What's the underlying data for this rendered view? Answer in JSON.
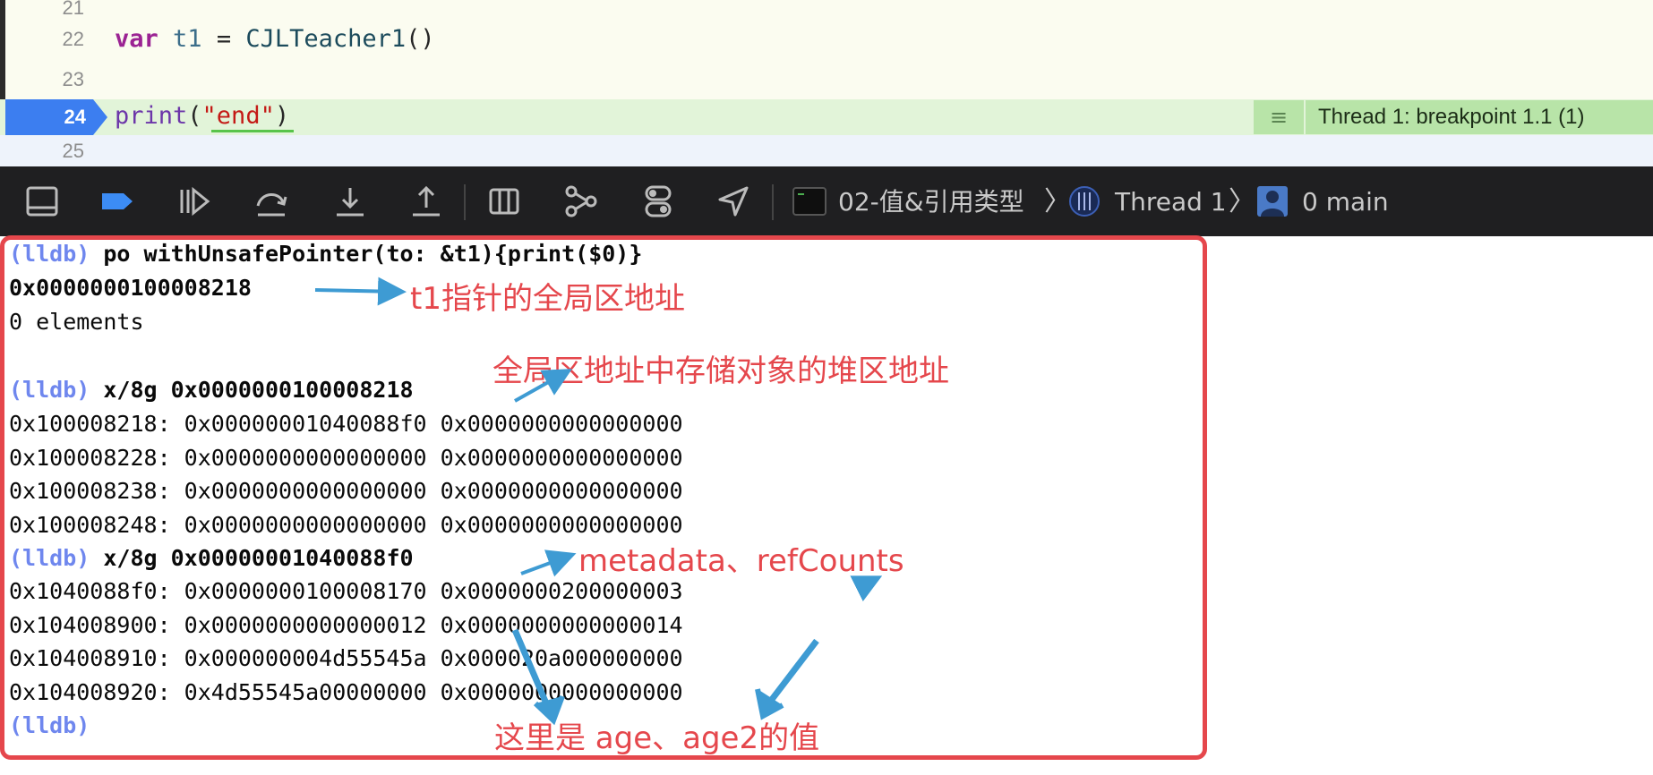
{
  "editor": {
    "lines": [
      {
        "num": "21"
      },
      {
        "num": "22",
        "kw": "var",
        "ident": "t1",
        "eq": " = ",
        "type": "CJLTeacher1",
        "parens": "()"
      },
      {
        "num": "23"
      },
      {
        "num": "24",
        "fn": "print",
        "open": "(",
        "str": "\"end\"",
        "close": ")"
      },
      {
        "num": "25"
      }
    ],
    "thread_badge": "Thread 1: breakpoint 1.1 (1)"
  },
  "toolbar": {
    "target": "02-值&引用类型",
    "thread": "Thread 1",
    "frame": "0 main",
    "icons": [
      "hide-debug-area-icon",
      "breakpoint-toggle-icon",
      "continue-icon",
      "step-over-icon",
      "step-into-icon",
      "step-out-icon",
      "view-hierarchy-icon",
      "memory-graph-icon",
      "environment-overrides-icon",
      "simulate-location-icon",
      "target-icon",
      "thread-icon",
      "frame-icon"
    ]
  },
  "console": {
    "prompt": "(lldb)",
    "lines": [
      {
        "prompt": "(lldb)",
        "cmd": " po withUnsafePointer(to: &t1){print($0)}"
      },
      {
        "cmd": "0x0000000100008218"
      },
      {
        "text": "0 elements"
      },
      {
        "text": ""
      },
      {
        "prompt": "(lldb)",
        "cmd": " x/8g 0x0000000100008218"
      },
      {
        "text": "0x100008218: 0x00000001040088f0 0x0000000000000000"
      },
      {
        "text": "0x100008228: 0x0000000000000000 0x0000000000000000"
      },
      {
        "text": "0x100008238: 0x0000000000000000 0x0000000000000000"
      },
      {
        "text": "0x100008248: 0x0000000000000000 0x0000000000000000"
      },
      {
        "prompt": "(lldb)",
        "cmd": " x/8g 0x00000001040088f0"
      },
      {
        "text": "0x1040088f0: 0x0000000100008170 0x0000000200000003"
      },
      {
        "text": "0x104008900: 0x0000000000000012 0x0000000000000014"
      },
      {
        "text": "0x104008910: 0x000000004d55545a 0x000020a000000000"
      },
      {
        "text": "0x104008920: 0x4d55545a00000000 0x0000000000000000"
      },
      {
        "prompt": "(lldb)"
      }
    ]
  },
  "annotations": {
    "global_addr": "t1指针的全局区地址",
    "heap_addr": "全局区地址中存储对象的堆区地址",
    "metadata": "metadata、refCounts",
    "age": "这里是 age、age2的值"
  },
  "colors": {
    "annotation": "#e5474c",
    "arrow": "#3e9bd3",
    "lldb_prompt": "#6f87ee",
    "breakpoint": "#3c7ef0"
  }
}
